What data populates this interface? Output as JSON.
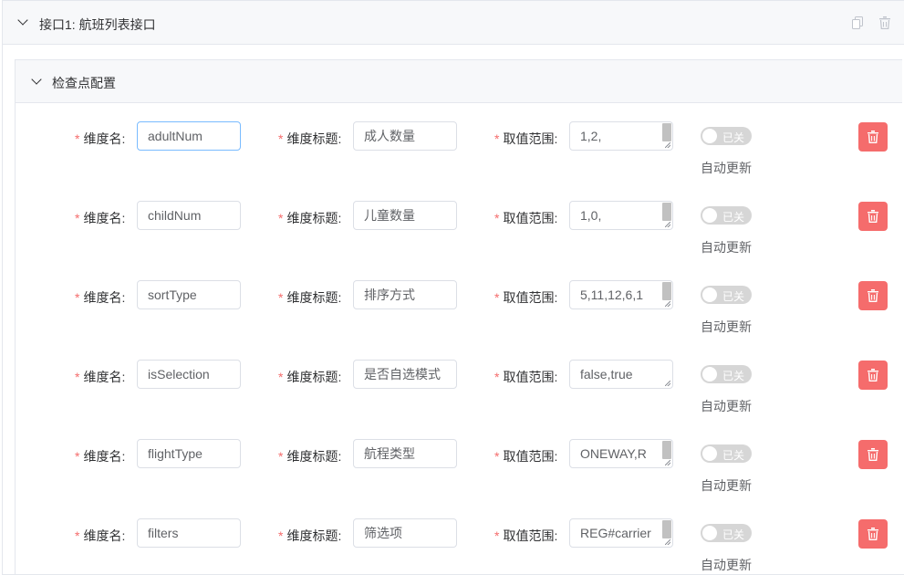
{
  "panel": {
    "title": "接口1: 航班列表接口"
  },
  "section": {
    "title": "检查点配置"
  },
  "labels": {
    "name": "维度名:",
    "title": "维度标题:",
    "range": "取值范围:",
    "required": "*"
  },
  "switch_off_text": "已关",
  "auto_update": "自动更新",
  "rows": [
    {
      "name": "adultNum",
      "title": "成人数量",
      "range": "1,2,"
    },
    {
      "name": "childNum",
      "title": "儿童数量",
      "range": "1,0,"
    },
    {
      "name": "sortType",
      "title": "排序方式",
      "range": "5,11,12,6,1"
    },
    {
      "name": "isSelection",
      "title": "是否自选模式",
      "range": "false,true"
    },
    {
      "name": "flightType",
      "title": "航程类型",
      "range": "ONEWAY,R"
    },
    {
      "name": "filters",
      "title": "筛选项",
      "range": "REG#carrier"
    }
  ],
  "colors": {
    "danger": "#f56c6c",
    "switch_off": "#d6d6d6",
    "focus_border": "#79bbff"
  }
}
